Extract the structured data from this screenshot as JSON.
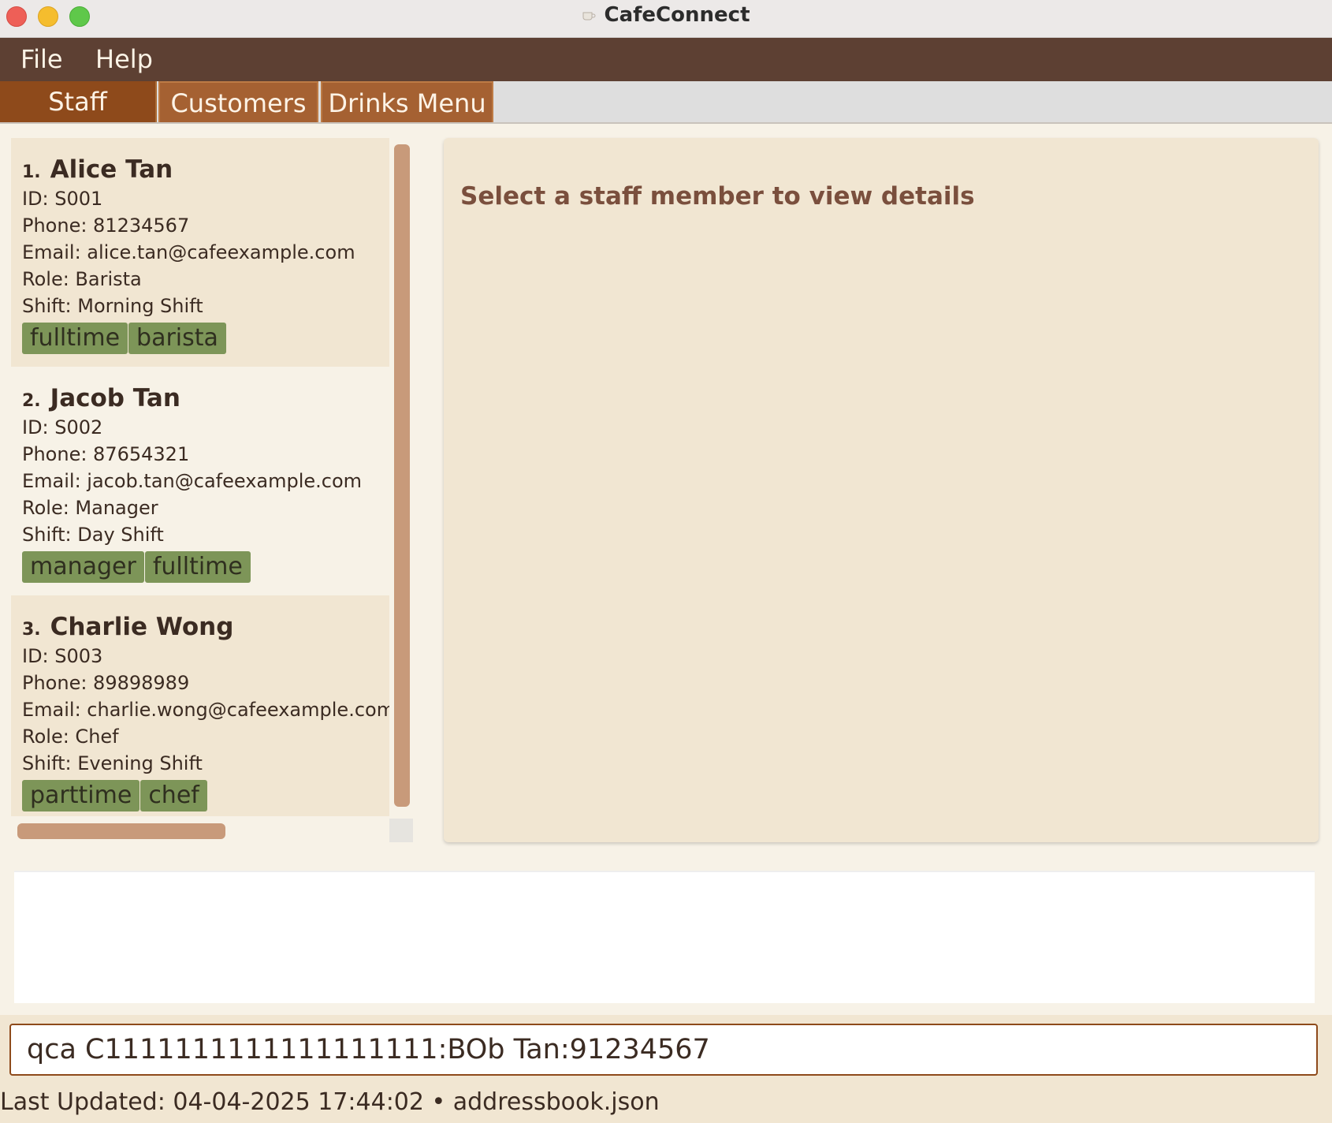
{
  "window": {
    "title": "CafeConnect",
    "icon": "coffee-cup-icon"
  },
  "menu": {
    "file": "File",
    "help": "Help"
  },
  "tabs": [
    {
      "label": "Staff",
      "active": true
    },
    {
      "label": "Customers",
      "active": false
    },
    {
      "label": "Drinks Menu",
      "active": false
    }
  ],
  "staff": [
    {
      "index": "1.",
      "name": "Alice Tan",
      "id": "ID: S001",
      "phone": "Phone: 81234567",
      "email": "Email: alice.tan@cafeexample.com",
      "role": "Role: Barista",
      "shift": "Shift: Morning Shift",
      "tags": [
        "fulltime",
        "barista"
      ]
    },
    {
      "index": "2.",
      "name": "Jacob Tan",
      "id": "ID: S002",
      "phone": "Phone: 87654321",
      "email": "Email: jacob.tan@cafeexample.com",
      "role": "Role: Manager",
      "shift": "Shift: Day Shift",
      "tags": [
        "manager",
        "fulltime"
      ]
    },
    {
      "index": "3.",
      "name": "Charlie Wong",
      "id": "ID: S003",
      "phone": "Phone: 89898989",
      "email": "Email: charlie.wong@cafeexample.com",
      "role": "Role: Chef",
      "shift": "Shift: Evening Shift",
      "tags": [
        "parttime",
        "chef"
      ]
    }
  ],
  "detail": {
    "placeholder": "Select a staff member to view details"
  },
  "result": {
    "text": ""
  },
  "command": {
    "value": "qca C1111111111111111111:BOb Tan:91234567"
  },
  "status": {
    "text": "Last Updated: 04-04-2025 17:44:02 • addressbook.json"
  },
  "colors": {
    "menubar": "#5d4033",
    "tab_active": "#8e4a1b",
    "tab_inactive": "#a56132",
    "card_bg": "#f1e6d2",
    "tag_bg": "#7d9558",
    "scroll_thumb": "#c89a7a"
  }
}
